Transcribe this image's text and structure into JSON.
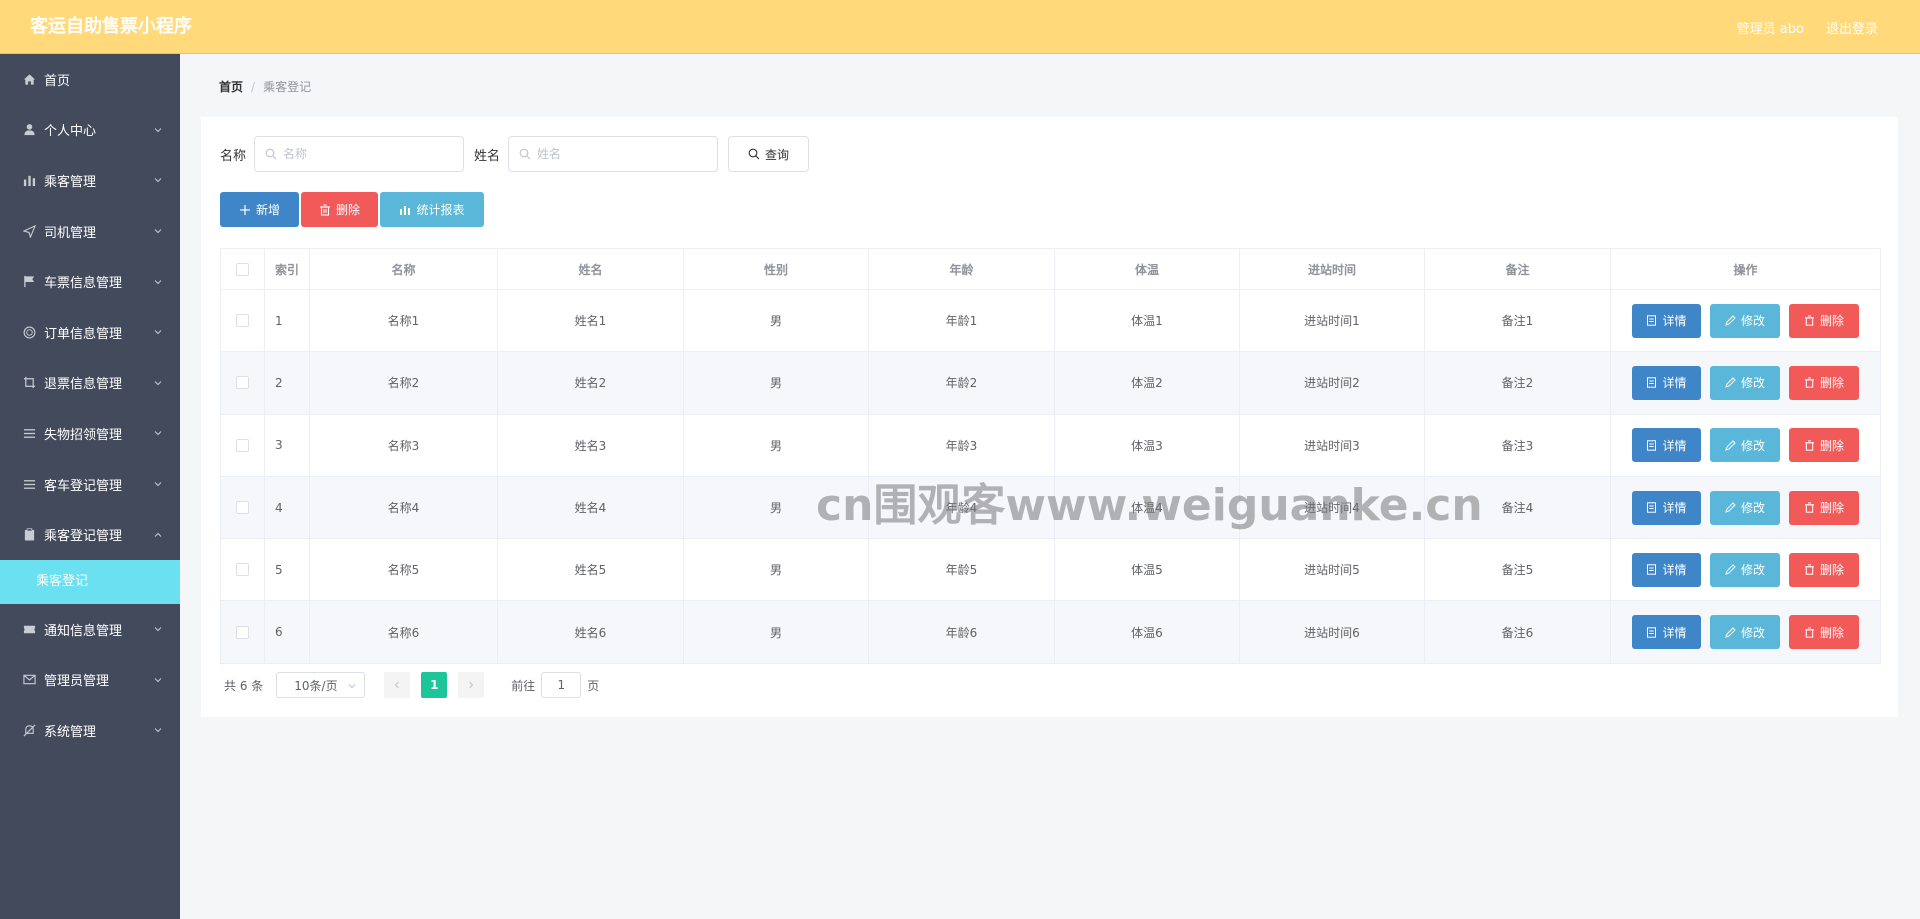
{
  "header": {
    "app_title": "客运自助售票小程序",
    "admin_label": "管理员 abo",
    "logout_label": "退出登录"
  },
  "sidebar": {
    "items": [
      {
        "label": "首页",
        "icon": "home-icon",
        "has_children": false
      },
      {
        "label": "个人中心",
        "icon": "user-icon",
        "has_children": true
      },
      {
        "label": "乘客管理",
        "icon": "bar-chart-icon",
        "has_children": true
      },
      {
        "label": "司机管理",
        "icon": "send-icon",
        "has_children": true
      },
      {
        "label": "车票信息管理",
        "icon": "flag-icon",
        "has_children": true
      },
      {
        "label": "订单信息管理",
        "icon": "coin-icon",
        "has_children": true
      },
      {
        "label": "退票信息管理",
        "icon": "crop-icon",
        "has_children": true
      },
      {
        "label": "失物招领管理",
        "icon": "list-icon",
        "has_children": true
      },
      {
        "label": "客车登记管理",
        "icon": "list-icon",
        "has_children": true
      },
      {
        "label": "乘客登记管理",
        "icon": "clipboard-icon",
        "has_children": true,
        "expanded": true
      },
      {
        "label": "通知信息管理",
        "icon": "ticket-icon",
        "has_children": true
      },
      {
        "label": "管理员管理",
        "icon": "mail-icon",
        "has_children": true
      },
      {
        "label": "系统管理",
        "icon": "bell-off-icon",
        "has_children": true
      }
    ],
    "active_sub": "乘客登记"
  },
  "breadcrumb": {
    "home": "首页",
    "separator": "/",
    "current": "乘客登记"
  },
  "search": {
    "name_label": "名称",
    "name_placeholder": "名称",
    "xm_label": "姓名",
    "xm_placeholder": "姓名",
    "query_label": "查询"
  },
  "actions": {
    "add_label": "新增",
    "delete_label": "删除",
    "report_label": "统计报表"
  },
  "table": {
    "columns": [
      "索引",
      "名称",
      "姓名",
      "性别",
      "年龄",
      "体温",
      "进站时间",
      "备注",
      "操作"
    ],
    "rows": [
      {
        "idx": "1",
        "name": "名称1",
        "xm": "姓名1",
        "sex": "男",
        "age": "年龄1",
        "tw": "体温1",
        "time": "进站时间1",
        "bz": "备注1"
      },
      {
        "idx": "2",
        "name": "名称2",
        "xm": "姓名2",
        "sex": "男",
        "age": "年龄2",
        "tw": "体温2",
        "time": "进站时间2",
        "bz": "备注2"
      },
      {
        "idx": "3",
        "name": "名称3",
        "xm": "姓名3",
        "sex": "男",
        "age": "年龄3",
        "tw": "体温3",
        "time": "进站时间3",
        "bz": "备注3"
      },
      {
        "idx": "4",
        "name": "名称4",
        "xm": "姓名4",
        "sex": "男",
        "age": "年龄4",
        "tw": "体温4",
        "time": "进站时间4",
        "bz": "备注4"
      },
      {
        "idx": "5",
        "name": "名称5",
        "xm": "姓名5",
        "sex": "男",
        "age": "年龄5",
        "tw": "体温5",
        "time": "进站时间5",
        "bz": "备注5"
      },
      {
        "idx": "6",
        "name": "名称6",
        "xm": "姓名6",
        "sex": "男",
        "age": "年龄6",
        "tw": "体温6",
        "time": "进站时间6",
        "bz": "备注6"
      }
    ],
    "row_actions": {
      "detail": "详情",
      "edit": "修改",
      "delete": "删除"
    }
  },
  "pagination": {
    "total": "共 6 条",
    "page_size": "10条/页",
    "current_page": "1",
    "goto_prefix": "前往",
    "goto_value": "1",
    "goto_suffix": "页"
  },
  "watermark": "cn围观客www.weiguanke.cn",
  "colors": {
    "header_bg": "#ffd97a",
    "sidebar_bg": "#424a5b",
    "sub_active_bg": "#6be0f0",
    "primary": "#3f86c9",
    "danger": "#f25a5a",
    "info": "#5ab7d9",
    "pager_active": "#1fc59a"
  }
}
